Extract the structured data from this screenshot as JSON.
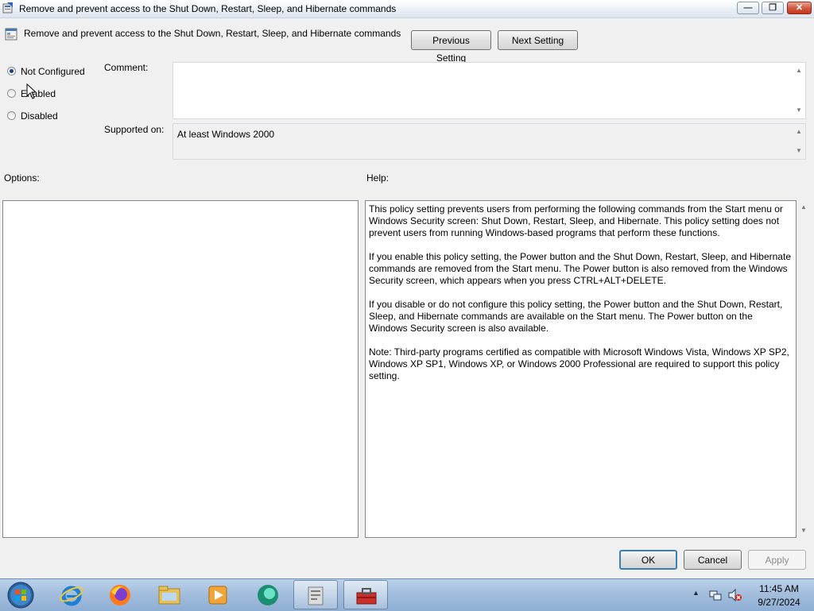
{
  "window": {
    "title": "Remove and prevent access to the Shut Down, Restart, Sleep, and Hibernate commands",
    "controls": {
      "minimize_icon": "minimize-icon",
      "maximize_icon": "maximize-icon",
      "close_icon": "close-icon"
    }
  },
  "header": {
    "policy_title": "Remove and prevent access to the Shut Down, Restart, Sleep, and Hibernate commands",
    "previous_label": "Previous Setting",
    "next_label": "Next Setting"
  },
  "state": {
    "options": [
      {
        "label": "Not Configured",
        "checked": true
      },
      {
        "label": "Enabled",
        "checked": false
      },
      {
        "label": "Disabled",
        "checked": false
      }
    ]
  },
  "comment": {
    "label": "Comment:",
    "value": ""
  },
  "supported": {
    "label": "Supported on:",
    "value": "At least Windows 2000"
  },
  "options_section": {
    "label": "Options:"
  },
  "help_section": {
    "label": "Help:",
    "paragraphs": [
      "This policy setting prevents users from performing the following commands from the Start menu or Windows Security screen: Shut Down, Restart, Sleep, and Hibernate. This policy setting does not prevent users from running Windows-based programs that perform these functions.",
      "If you enable this policy setting, the Power button and the Shut Down, Restart, Sleep, and Hibernate commands are removed from the Start menu. The Power button is also removed from the Windows Security screen, which appears when you press CTRL+ALT+DELETE.",
      "If you disable or do not configure this policy setting, the Power button and the Shut Down, Restart, Sleep, and Hibernate commands are available on the Start menu. The Power button on the Windows Security screen is also available.",
      "Note: Third-party programs certified as compatible with Microsoft Windows Vista, Windows XP SP2, Windows XP SP1, Windows XP, or Windows 2000 Professional are required to support this policy setting."
    ]
  },
  "footer": {
    "ok_label": "OK",
    "cancel_label": "Cancel",
    "apply_label": "Apply"
  },
  "taskbar": {
    "apps": [
      "start-orb",
      "internet-explorer-icon",
      "firefox-icon",
      "file-explorer-icon",
      "media-player-icon",
      "green-app-icon",
      "gpedit-icon",
      "toolbox-icon"
    ],
    "clock_time": "11:45 AM",
    "clock_date": "9/27/2024"
  },
  "colors": {
    "title_bar": "#e9eef5",
    "taskbar": "#a6c0de",
    "close_button": "#c5361c",
    "ok_border": "#3c7fb1"
  }
}
